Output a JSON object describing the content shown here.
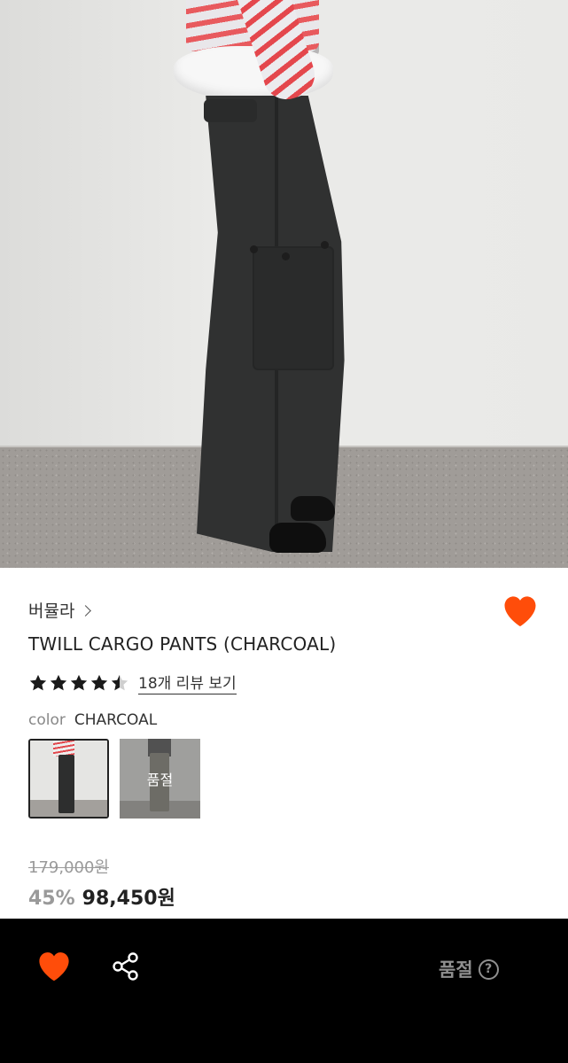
{
  "product": {
    "brand": "버뮬라",
    "title": "TWILL CARGO PANTS (CHARCOAL)",
    "rating": 4.5,
    "review_link": "18개 리뷰 보기",
    "color_label": "color",
    "color_value": "CHARCOAL",
    "swatches": [
      {
        "name": "charcoal",
        "selected": true
      },
      {
        "name": "khaki",
        "overlay_text": "품절"
      }
    ],
    "original_price": "179,000원",
    "discount": "45%",
    "sale_price": "98,450원"
  },
  "bottom_bar": {
    "status": "품절",
    "help": "?"
  },
  "colors": {
    "heart": "#ff4d0a",
    "bar_bg": "#000000",
    "muted": "#8f8f8f"
  },
  "icons": [
    "chevron-right-icon",
    "heart-icon",
    "star-icon",
    "half-star-icon",
    "share-icon",
    "question-icon"
  ]
}
